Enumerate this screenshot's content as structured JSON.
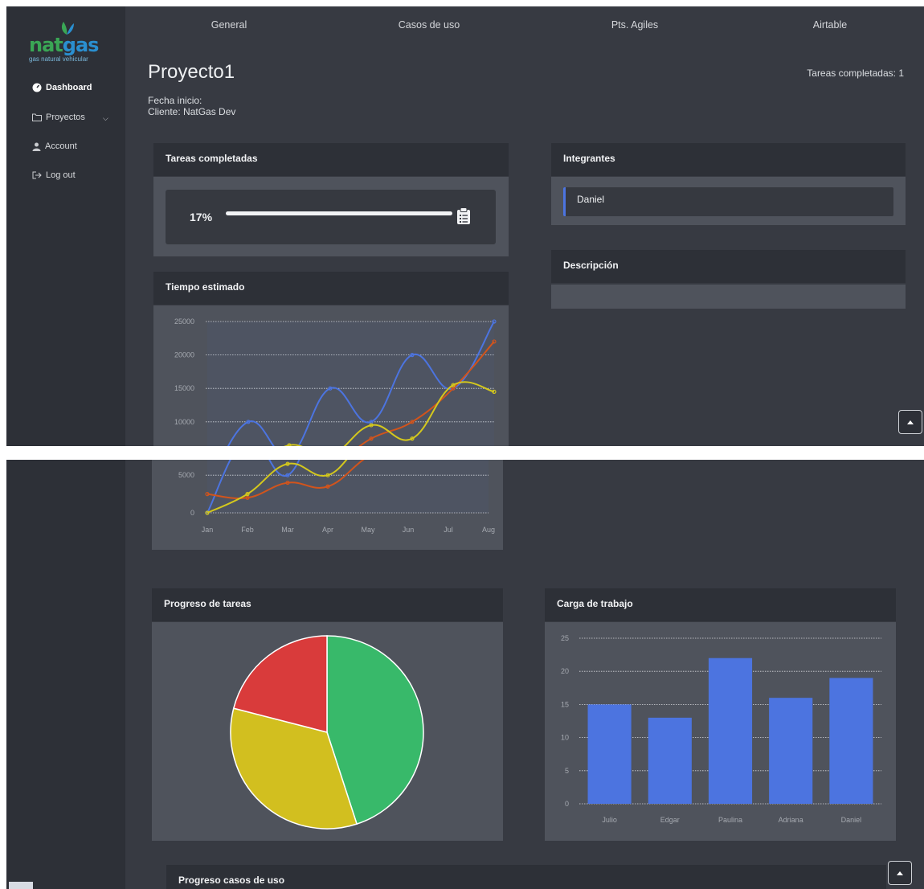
{
  "brand": {
    "part1": "nat",
    "part2": "gas",
    "tagline": "gas natural vehicular"
  },
  "sidebar": {
    "items": [
      {
        "label": "Dashboard",
        "icon": "tachometer-icon",
        "active": true
      },
      {
        "label": "Proyectos",
        "icon": "folder-icon",
        "expandable": true
      },
      {
        "label": "Account",
        "icon": "user-icon"
      },
      {
        "label": "Log out",
        "icon": "sign-out-icon"
      }
    ]
  },
  "topnav": {
    "tabs": [
      "General",
      "Casos de uso",
      "Pts. Agiles",
      "Airtable"
    ]
  },
  "project": {
    "title": "Proyecto1",
    "start_label": "Fecha inicio:",
    "client_label": "Cliente: NatGas Dev",
    "tasks_done": "Tareas completadas: 1"
  },
  "cards": {
    "tasks": {
      "title": "Tareas completadas",
      "percent_label": "17%",
      "progress": 1.0
    },
    "members": {
      "title": "Integrantes",
      "list": [
        "Daniel"
      ]
    },
    "description": {
      "title": "Descripción"
    },
    "estimated_time": {
      "title": "Tiempo estimado"
    },
    "task_progress": {
      "title": "Progreso de tareas"
    },
    "workload": {
      "title": "Carga de trabajo"
    },
    "use_cases": {
      "title": "Progreso casos de uso"
    }
  },
  "colors": {
    "blue": "#4c74e0",
    "orange": "#d2541c",
    "yellow": "#d4c81d",
    "green": "#38b96a",
    "red": "#d93b3b",
    "pie_yellow": "#d2bf1f"
  },
  "chart_data": [
    {
      "type": "line",
      "title": "Tiempo estimado",
      "categories": [
        "Jan",
        "Feb",
        "Mar",
        "Apr",
        "May",
        "Jun",
        "Jul",
        "Aug"
      ],
      "ylim": [
        0,
        25000
      ],
      "yticks": [
        0,
        5000,
        10000,
        15000,
        20000,
        25000
      ],
      "grid": true,
      "series": [
        {
          "values": [
            0,
            10000,
            5000,
            15000,
            10000,
            20000,
            15000,
            25000
          ],
          "color": "#4c74e0"
        },
        {
          "values": [
            2500,
            2000,
            4000,
            3500,
            7500,
            10000,
            15000,
            22000
          ],
          "color": "#d2541c"
        },
        {
          "values": [
            0,
            2500,
            6500,
            5000,
            9500,
            7500,
            15500,
            14500
          ],
          "color": "#d4c81d"
        }
      ]
    },
    {
      "type": "pie",
      "title": "Progreso de tareas",
      "values": [
        45,
        34,
        21
      ],
      "colors": [
        "#38b96a",
        "#d2bf1f",
        "#d93b3b"
      ]
    },
    {
      "type": "bar",
      "title": "Carga de trabajo",
      "categories": [
        "Julio",
        "Edgar",
        "Paulina",
        "Adriana",
        "Daniel"
      ],
      "values": [
        15,
        13,
        22,
        16,
        19
      ],
      "ylim": [
        0,
        25
      ],
      "yticks": [
        0,
        5,
        10,
        15,
        20,
        25
      ],
      "grid": true,
      "color": "#4c74e0"
    }
  ]
}
